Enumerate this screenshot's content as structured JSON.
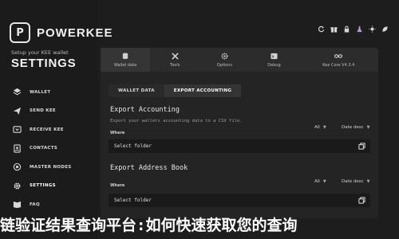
{
  "brand": {
    "logo_letter": "P",
    "name": "POWERKEE"
  },
  "setup": {
    "subtitle": "Setup your KEE wallet",
    "title": "SETTINGS"
  },
  "nav": [
    {
      "label": "WALLET",
      "icon": "layers-icon"
    },
    {
      "label": "SEND KEE",
      "icon": "send-icon"
    },
    {
      "label": "RECEIVE KEE",
      "icon": "receive-icon"
    },
    {
      "label": "CONTACTS",
      "icon": "contacts-icon"
    },
    {
      "label": "MASTER NODES",
      "icon": "nodes-icon"
    },
    {
      "label": "SETTINGS",
      "icon": "gear-icon"
    },
    {
      "label": "FAQ",
      "icon": "book-icon"
    }
  ],
  "top_icons": [
    "refresh-icon",
    "gift-icon",
    "lock-icon",
    "flask-icon",
    "sun-icon",
    "leaf-icon"
  ],
  "tabs": [
    {
      "label": "Wallet data",
      "icon": "database-icon"
    },
    {
      "label": "Tools",
      "icon": "tools-icon"
    },
    {
      "label": "Options",
      "icon": "options-icon"
    },
    {
      "label": "Debug",
      "icon": "debug-icon"
    },
    {
      "label": "Kee Core V4.3.4",
      "icon": "link-icon"
    }
  ],
  "subtabs": [
    "WALLET DATA",
    "EXPORT ACCOUNTING"
  ],
  "export_accounting": {
    "title": "Export Accounting",
    "description": "Export your wallets accounting data to a CSV file.",
    "where_label": "Where",
    "filter_all": "All",
    "filter_date": "Date desc",
    "folder_value": "Select folder"
  },
  "export_address_book": {
    "title": "Export Address Book",
    "where_label": "Where",
    "filter_all": "All",
    "filter_date": "Date desc",
    "folder_value": "Select folder"
  },
  "headline": "链验证结果查询平台:如何快速获取您的查询"
}
